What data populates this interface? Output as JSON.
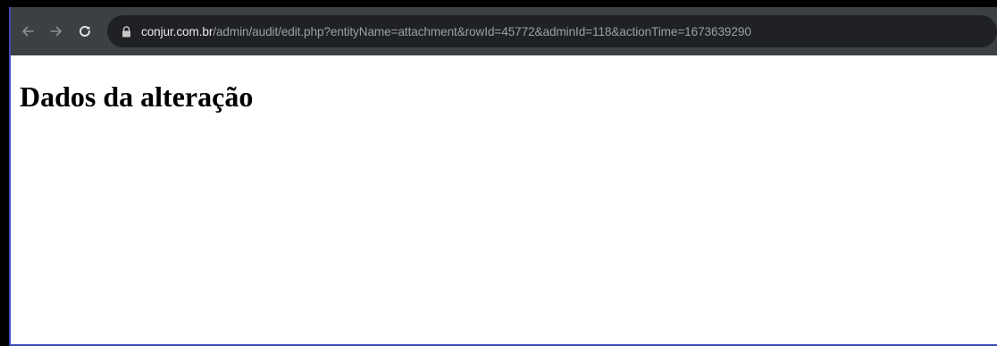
{
  "browser": {
    "url_domain": "conjur.com.br",
    "url_path": "/admin/audit/edit.php?entityName=attachment&rowId=45772&adminId=118&actionTime=1673639290",
    "icons": [
      "back-arrow-icon",
      "forward-arrow-icon",
      "reload-icon",
      "lock-icon"
    ],
    "toolbar_color": "#3c4043",
    "omnibox_color": "#202124"
  },
  "page": {
    "title": "Dados da alteração"
  }
}
